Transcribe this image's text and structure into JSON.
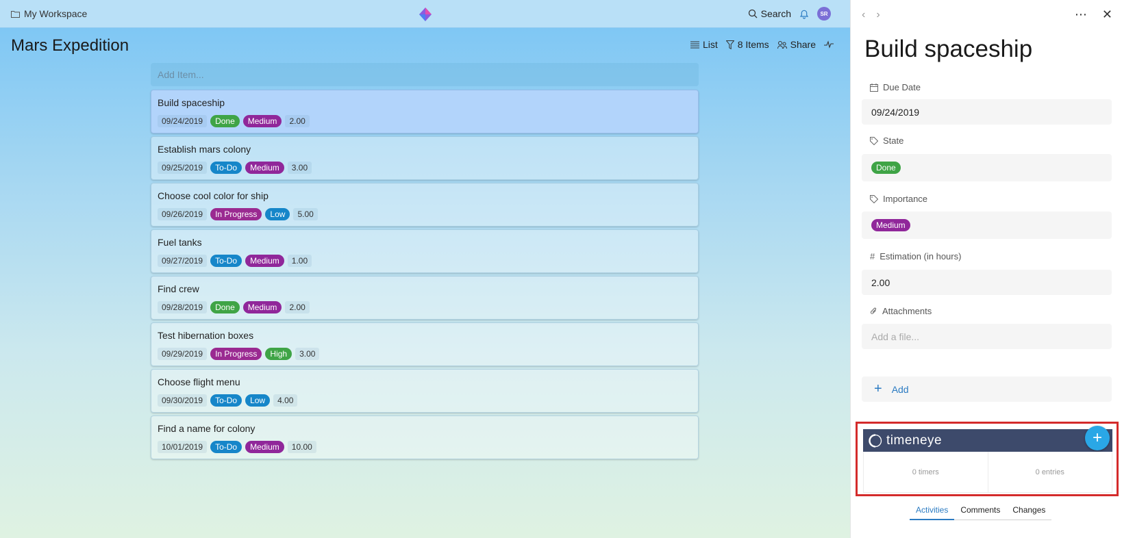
{
  "colors": {
    "done": "#3fa446",
    "todo": "#1686c9",
    "inprogress": "#9a2a91",
    "medium": "#90279a",
    "low": "#1686c9",
    "high": "#3fa446",
    "accent": "#2b7bc2",
    "timeeye_header": "#3d4a6b",
    "highlight_frame": "#d42b2b"
  },
  "topbar": {
    "workspace": "My Workspace",
    "search_label": "Search",
    "avatar_initials": "SR"
  },
  "main": {
    "title": "Mars Expedition",
    "toolbar": {
      "list_label": "List",
      "items_label": "8 Items",
      "share_label": "Share"
    },
    "add_item_placeholder": "Add Item...",
    "items": [
      {
        "title": "Build spaceship",
        "date": "09/24/2019",
        "state": "Done",
        "importance": "Medium",
        "estimate": "2.00",
        "selected": true
      },
      {
        "title": "Establish mars colony",
        "date": "09/25/2019",
        "state": "To-Do",
        "importance": "Medium",
        "estimate": "3.00"
      },
      {
        "title": "Choose cool color for ship",
        "date": "09/26/2019",
        "state": "In Progress",
        "importance": "Low",
        "estimate": "5.00"
      },
      {
        "title": "Fuel tanks",
        "date": "09/27/2019",
        "state": "To-Do",
        "importance": "Medium",
        "estimate": "1.00"
      },
      {
        "title": "Find crew",
        "date": "09/28/2019",
        "state": "Done",
        "importance": "Medium",
        "estimate": "2.00"
      },
      {
        "title": "Test hibernation boxes",
        "date": "09/29/2019",
        "state": "In Progress",
        "importance": "High",
        "estimate": "3.00"
      },
      {
        "title": "Choose flight menu",
        "date": "09/30/2019",
        "state": "To-Do",
        "importance": "Low",
        "estimate": "4.00"
      },
      {
        "title": "Find a name for colony",
        "date": "10/01/2019",
        "state": "To-Do",
        "importance": "Medium",
        "estimate": "10.00"
      }
    ]
  },
  "panel": {
    "title": "Build spaceship",
    "fields": {
      "due_date": {
        "label": "Due Date",
        "value": "09/24/2019"
      },
      "state": {
        "label": "State",
        "value": "Done"
      },
      "importance": {
        "label": "Importance",
        "value": "Medium"
      },
      "estimation": {
        "label": "Estimation (in hours)",
        "value": "2.00"
      },
      "attachments": {
        "label": "Attachments",
        "placeholder": "Add a file..."
      }
    },
    "add_label": "Add",
    "timeeye": {
      "name": "timeneye",
      "timers": "0 timers",
      "entries": "0 entries"
    },
    "tabs": [
      "Activities",
      "Comments",
      "Changes"
    ],
    "active_tab": 0
  }
}
